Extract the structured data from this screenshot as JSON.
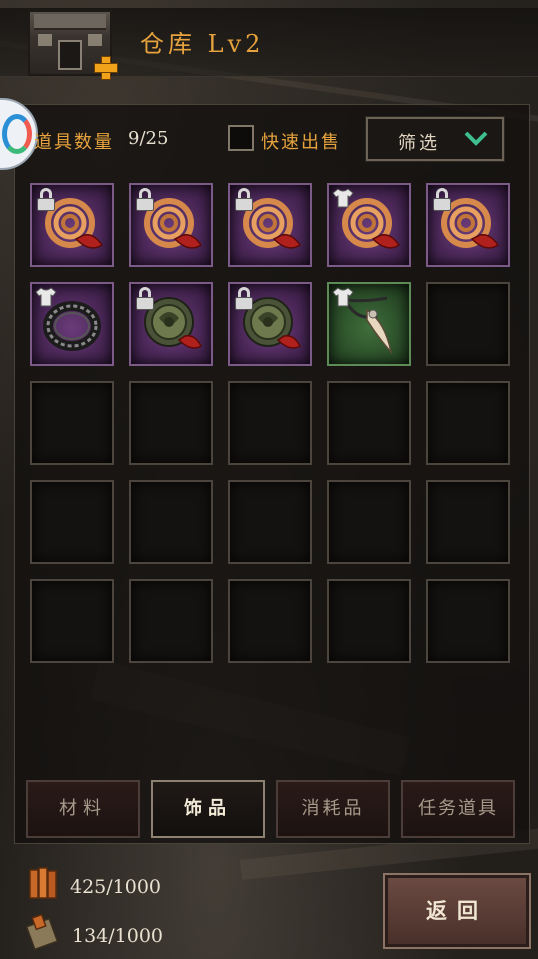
{
  "header": {
    "title": "仓库 Lv2"
  },
  "inventory": {
    "count_label": "道具数量",
    "count_value": "9/25",
    "quick_sell_label": "快速出售",
    "filter_label": "筛选"
  },
  "slots": [
    {
      "rarity": "purple",
      "badge": "lock",
      "item": "rope-coil-icon"
    },
    {
      "rarity": "purple",
      "badge": "lock",
      "item": "rope-coil-icon"
    },
    {
      "rarity": "purple",
      "badge": "lock",
      "item": "rope-coil-icon"
    },
    {
      "rarity": "purple",
      "badge": "shirt",
      "item": "rope-coil-icon"
    },
    {
      "rarity": "purple",
      "badge": "lock",
      "item": "rope-coil-icon"
    },
    {
      "rarity": "purple",
      "badge": "shirt",
      "item": "ring-icon"
    },
    {
      "rarity": "purple",
      "badge": "lock",
      "item": "jade-pendant-icon"
    },
    {
      "rarity": "purple",
      "badge": "lock",
      "item": "jade-pendant-icon"
    },
    {
      "rarity": "green",
      "badge": "shirt",
      "item": "tooth-necklace-icon"
    },
    {
      "rarity": "empty"
    },
    {
      "rarity": "empty"
    },
    {
      "rarity": "empty"
    },
    {
      "rarity": "empty"
    },
    {
      "rarity": "empty"
    },
    {
      "rarity": "empty"
    },
    {
      "rarity": "empty"
    },
    {
      "rarity": "empty"
    },
    {
      "rarity": "empty"
    },
    {
      "rarity": "empty"
    },
    {
      "rarity": "empty"
    },
    {
      "rarity": "empty"
    },
    {
      "rarity": "empty"
    },
    {
      "rarity": "empty"
    },
    {
      "rarity": "empty"
    },
    {
      "rarity": "empty"
    }
  ],
  "tabs": [
    {
      "label": "材料",
      "active": false
    },
    {
      "label": "饰品",
      "active": true
    },
    {
      "label": "消耗品",
      "active": false
    },
    {
      "label": "任务道具",
      "active": false
    }
  ],
  "resources": [
    {
      "icon": "wood-planks-icon",
      "value": "425/1000"
    },
    {
      "icon": "cloth-bundle-icon",
      "value": "134/1000"
    }
  ],
  "buttons": {
    "back_label": "返回"
  },
  "colors": {
    "accent": "#e6a23c",
    "purple_rarity": "#4a2757",
    "green_rarity": "#2a4d28"
  }
}
